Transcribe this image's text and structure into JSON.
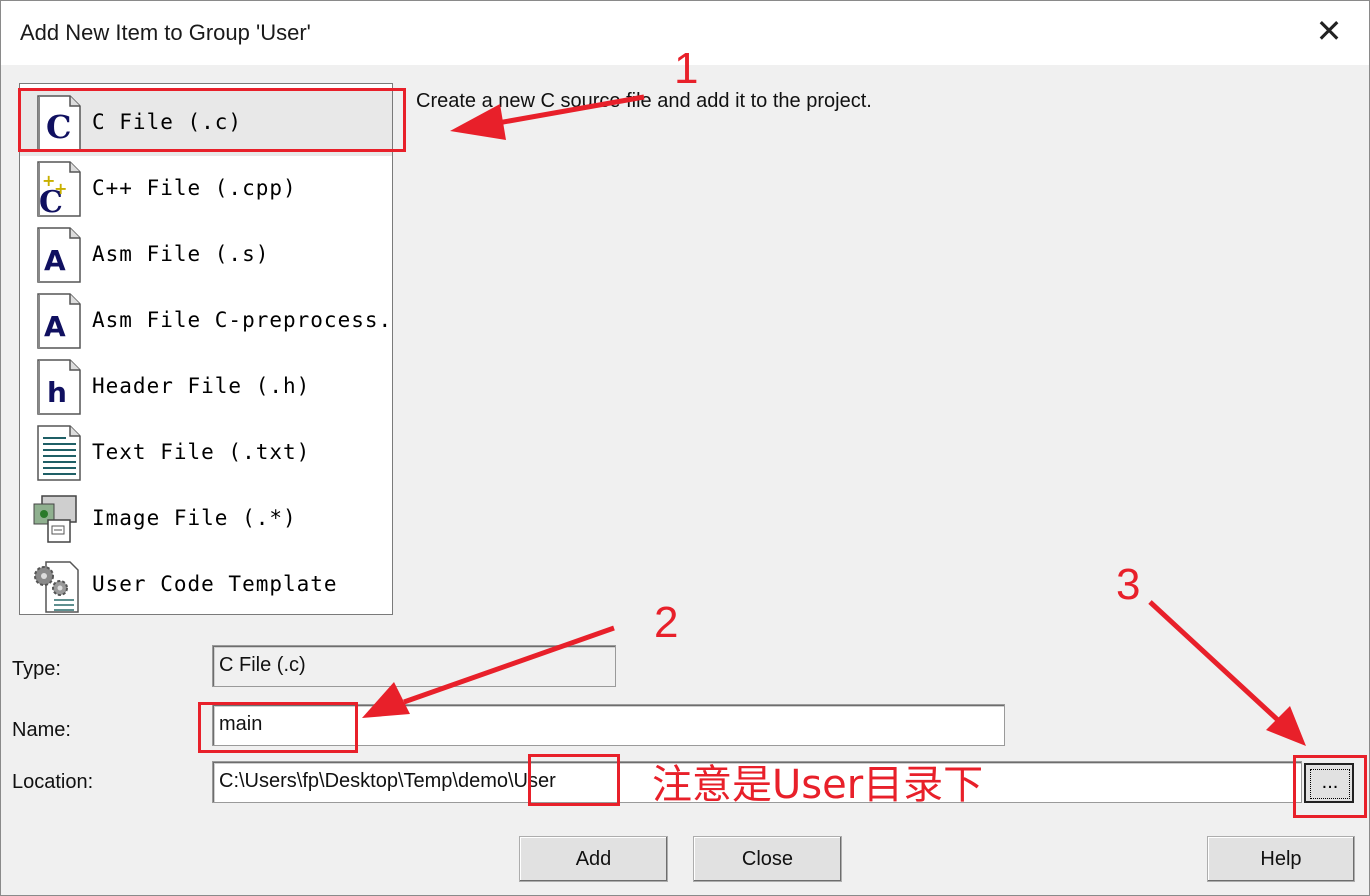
{
  "dialog": {
    "title": "Add New Item to Group 'User'",
    "close_glyph": "✕"
  },
  "file_types": [
    {
      "label": "C File (.c)",
      "icon": "c-file-icon"
    },
    {
      "label": "C++ File (.cpp)",
      "icon": "cpp-file-icon"
    },
    {
      "label": "Asm File (.s)",
      "icon": "asm-file-icon"
    },
    {
      "label": "Asm File C-preprocess...",
      "icon": "asm-preprocess-file-icon"
    },
    {
      "label": "Header File (.h)",
      "icon": "header-file-icon"
    },
    {
      "label": "Text File (.txt)",
      "icon": "text-file-icon"
    },
    {
      "label": "Image File (.*)",
      "icon": "image-file-icon"
    },
    {
      "label": "User Code Template",
      "icon": "user-code-template-icon"
    }
  ],
  "selected_index": 0,
  "description": "Create a new C source file and add it to the project.",
  "form": {
    "type_label": "Type:",
    "type_value": "C File (.c)",
    "name_label": "Name:",
    "name_value": "main",
    "location_label": "Location:",
    "location_value": "C:\\Users\\fp\\Desktop\\Temp\\demo\\User",
    "browse_label": "..."
  },
  "buttons": {
    "add": "Add",
    "close": "Close",
    "help": "Help"
  },
  "annotations": {
    "num1": "1",
    "num2": "2",
    "num3": "3",
    "note": "注意是User目录下",
    "color": "#e8202a"
  }
}
